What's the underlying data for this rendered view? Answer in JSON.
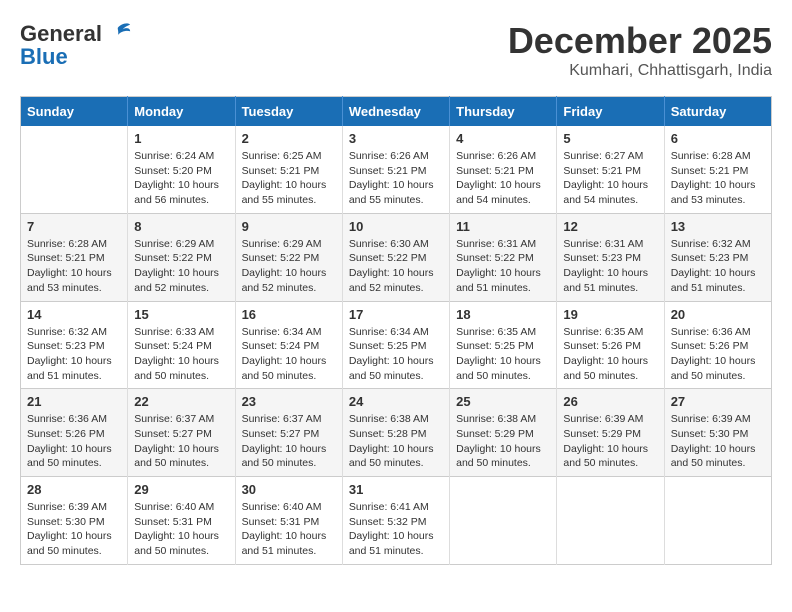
{
  "header": {
    "logo_line1": "General",
    "logo_line2": "Blue",
    "month": "December 2025",
    "location": "Kumhari, Chhattisgarh, India"
  },
  "weekdays": [
    "Sunday",
    "Monday",
    "Tuesday",
    "Wednesday",
    "Thursday",
    "Friday",
    "Saturday"
  ],
  "weeks": [
    [
      {
        "day": "",
        "info": ""
      },
      {
        "day": "1",
        "info": "Sunrise: 6:24 AM\nSunset: 5:20 PM\nDaylight: 10 hours\nand 56 minutes."
      },
      {
        "day": "2",
        "info": "Sunrise: 6:25 AM\nSunset: 5:21 PM\nDaylight: 10 hours\nand 55 minutes."
      },
      {
        "day": "3",
        "info": "Sunrise: 6:26 AM\nSunset: 5:21 PM\nDaylight: 10 hours\nand 55 minutes."
      },
      {
        "day": "4",
        "info": "Sunrise: 6:26 AM\nSunset: 5:21 PM\nDaylight: 10 hours\nand 54 minutes."
      },
      {
        "day": "5",
        "info": "Sunrise: 6:27 AM\nSunset: 5:21 PM\nDaylight: 10 hours\nand 54 minutes."
      },
      {
        "day": "6",
        "info": "Sunrise: 6:28 AM\nSunset: 5:21 PM\nDaylight: 10 hours\nand 53 minutes."
      }
    ],
    [
      {
        "day": "7",
        "info": "Sunrise: 6:28 AM\nSunset: 5:21 PM\nDaylight: 10 hours\nand 53 minutes."
      },
      {
        "day": "8",
        "info": "Sunrise: 6:29 AM\nSunset: 5:22 PM\nDaylight: 10 hours\nand 52 minutes."
      },
      {
        "day": "9",
        "info": "Sunrise: 6:29 AM\nSunset: 5:22 PM\nDaylight: 10 hours\nand 52 minutes."
      },
      {
        "day": "10",
        "info": "Sunrise: 6:30 AM\nSunset: 5:22 PM\nDaylight: 10 hours\nand 52 minutes."
      },
      {
        "day": "11",
        "info": "Sunrise: 6:31 AM\nSunset: 5:22 PM\nDaylight: 10 hours\nand 51 minutes."
      },
      {
        "day": "12",
        "info": "Sunrise: 6:31 AM\nSunset: 5:23 PM\nDaylight: 10 hours\nand 51 minutes."
      },
      {
        "day": "13",
        "info": "Sunrise: 6:32 AM\nSunset: 5:23 PM\nDaylight: 10 hours\nand 51 minutes."
      }
    ],
    [
      {
        "day": "14",
        "info": "Sunrise: 6:32 AM\nSunset: 5:23 PM\nDaylight: 10 hours\nand 51 minutes."
      },
      {
        "day": "15",
        "info": "Sunrise: 6:33 AM\nSunset: 5:24 PM\nDaylight: 10 hours\nand 50 minutes."
      },
      {
        "day": "16",
        "info": "Sunrise: 6:34 AM\nSunset: 5:24 PM\nDaylight: 10 hours\nand 50 minutes."
      },
      {
        "day": "17",
        "info": "Sunrise: 6:34 AM\nSunset: 5:25 PM\nDaylight: 10 hours\nand 50 minutes."
      },
      {
        "day": "18",
        "info": "Sunrise: 6:35 AM\nSunset: 5:25 PM\nDaylight: 10 hours\nand 50 minutes."
      },
      {
        "day": "19",
        "info": "Sunrise: 6:35 AM\nSunset: 5:26 PM\nDaylight: 10 hours\nand 50 minutes."
      },
      {
        "day": "20",
        "info": "Sunrise: 6:36 AM\nSunset: 5:26 PM\nDaylight: 10 hours\nand 50 minutes."
      }
    ],
    [
      {
        "day": "21",
        "info": "Sunrise: 6:36 AM\nSunset: 5:26 PM\nDaylight: 10 hours\nand 50 minutes."
      },
      {
        "day": "22",
        "info": "Sunrise: 6:37 AM\nSunset: 5:27 PM\nDaylight: 10 hours\nand 50 minutes."
      },
      {
        "day": "23",
        "info": "Sunrise: 6:37 AM\nSunset: 5:27 PM\nDaylight: 10 hours\nand 50 minutes."
      },
      {
        "day": "24",
        "info": "Sunrise: 6:38 AM\nSunset: 5:28 PM\nDaylight: 10 hours\nand 50 minutes."
      },
      {
        "day": "25",
        "info": "Sunrise: 6:38 AM\nSunset: 5:29 PM\nDaylight: 10 hours\nand 50 minutes."
      },
      {
        "day": "26",
        "info": "Sunrise: 6:39 AM\nSunset: 5:29 PM\nDaylight: 10 hours\nand 50 minutes."
      },
      {
        "day": "27",
        "info": "Sunrise: 6:39 AM\nSunset: 5:30 PM\nDaylight: 10 hours\nand 50 minutes."
      }
    ],
    [
      {
        "day": "28",
        "info": "Sunrise: 6:39 AM\nSunset: 5:30 PM\nDaylight: 10 hours\nand 50 minutes."
      },
      {
        "day": "29",
        "info": "Sunrise: 6:40 AM\nSunset: 5:31 PM\nDaylight: 10 hours\nand 50 minutes."
      },
      {
        "day": "30",
        "info": "Sunrise: 6:40 AM\nSunset: 5:31 PM\nDaylight: 10 hours\nand 51 minutes."
      },
      {
        "day": "31",
        "info": "Sunrise: 6:41 AM\nSunset: 5:32 PM\nDaylight: 10 hours\nand 51 minutes."
      },
      {
        "day": "",
        "info": ""
      },
      {
        "day": "",
        "info": ""
      },
      {
        "day": "",
        "info": ""
      }
    ]
  ]
}
